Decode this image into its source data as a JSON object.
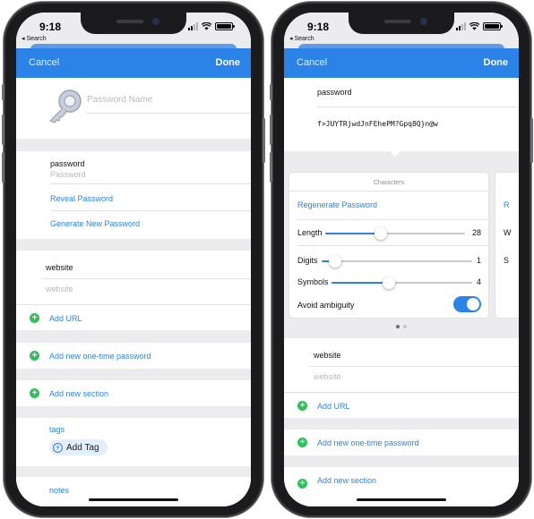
{
  "status": {
    "time": "9:18",
    "back_label": "◂ Search"
  },
  "nav": {
    "cancel": "Cancel",
    "done": "Done"
  },
  "left": {
    "title_placeholder": "Password Name",
    "password_label": "password",
    "password_placeholder": "Password",
    "reveal": "Reveal Password",
    "generate": "Generate New Password",
    "website_label": "website",
    "website_placeholder": "website",
    "add_url": "Add URL",
    "add_otp": "Add new one-time password",
    "add_section": "Add new section",
    "tags_label": "tags",
    "add_tag": "Add Tag",
    "notes_label": "notes"
  },
  "right": {
    "password_label": "password",
    "password_value": "f>JUYTRjwdJnFEhePM?Gpq8Q}n@w",
    "card_title": "Characters",
    "regenerate": "Regenerate Password",
    "peek_letters": [
      "R",
      "W",
      "S"
    ],
    "sliders": [
      {
        "label": "Length",
        "value": "28",
        "fraction": 0.4
      },
      {
        "label": "Digits",
        "value": "1",
        "fraction": 0.09
      },
      {
        "label": "Symbols",
        "value": "4",
        "fraction": 0.41
      }
    ],
    "avoid_ambiguity": "Avoid ambiguity",
    "avoid_ambiguity_on": true,
    "page_dots": {
      "count": 2,
      "active": 0
    },
    "website_label": "website",
    "website_placeholder": "website",
    "add_url": "Add URL",
    "add_otp": "Add new one-time password",
    "add_section": "Add new section"
  },
  "colors": {
    "accent": "#2b83e8",
    "add_green": "#2ec35a",
    "background": "#ececef"
  }
}
